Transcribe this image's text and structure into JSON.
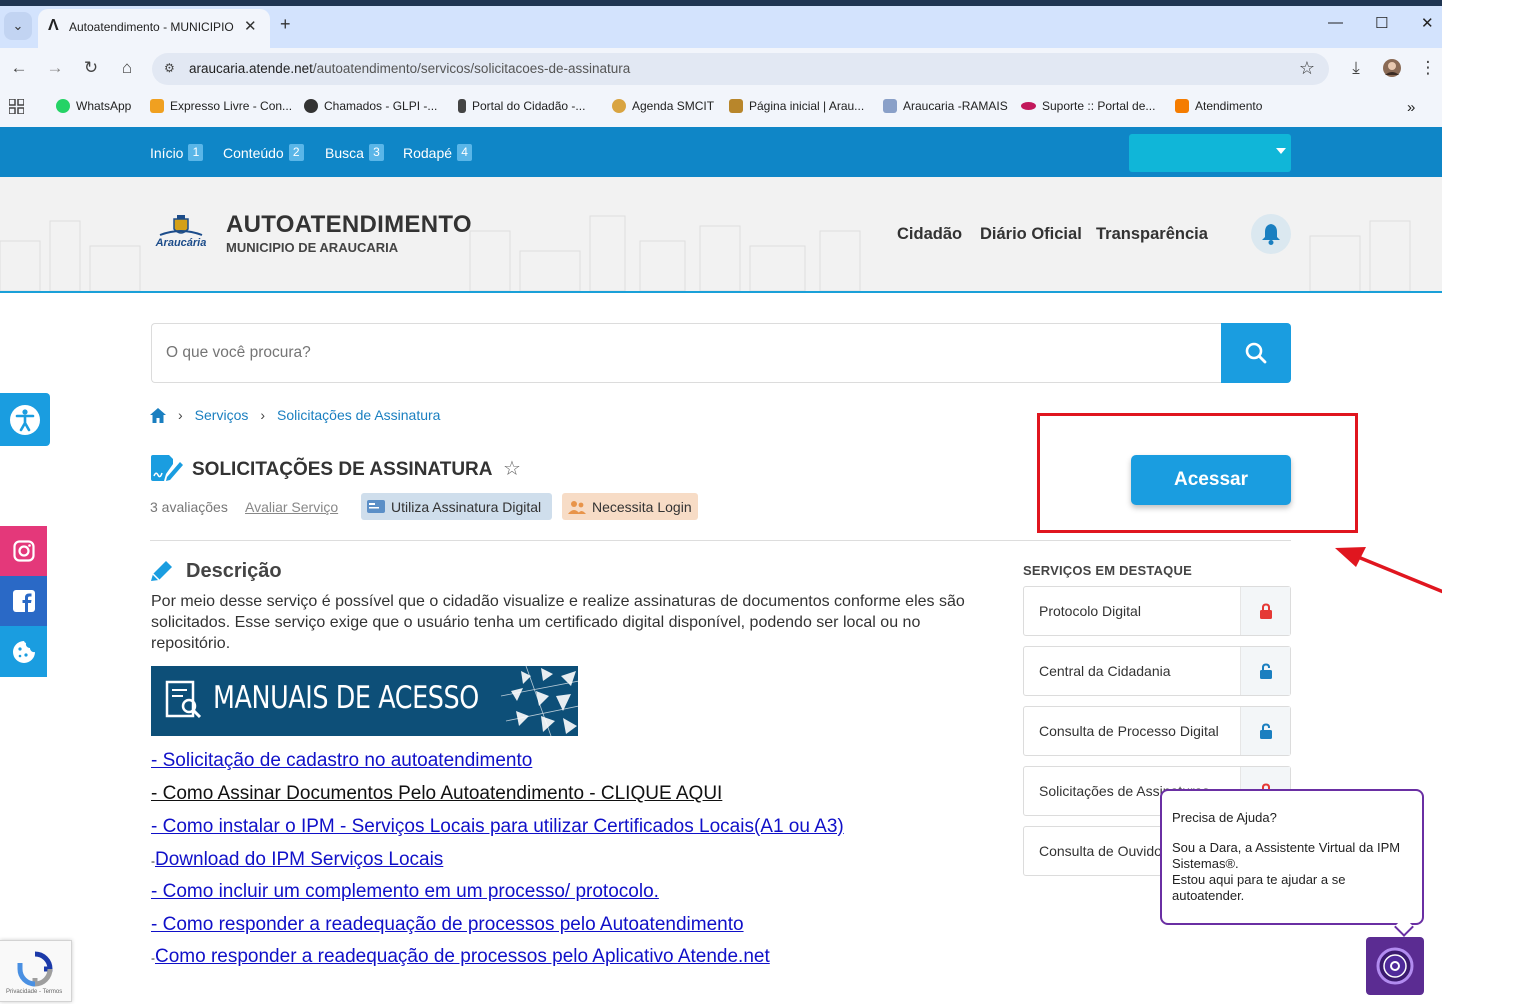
{
  "browser": {
    "tab_title": "Autoatendimento - MUNICIPIO",
    "url_host": "araucaria.atende.net",
    "url_path": "/autoatendimento/servicos/solicitacoes-de-assinatura",
    "bookmarks": [
      {
        "label": "WhatsApp",
        "color": "#25d366"
      },
      {
        "label": "Expresso Livre - Con...",
        "color": "#f0a020"
      },
      {
        "label": "Chamados - GLPI -...",
        "color": "#333333"
      },
      {
        "label": "Portal do Cidadão -...",
        "color": "#444444"
      },
      {
        "label": "Agenda SMCIT",
        "color": "#d9a441"
      },
      {
        "label": "Página inicial | Arau...",
        "color": "#b8862b"
      },
      {
        "label": "Araucaria -RAMAIS",
        "color": "#8aa0c8"
      },
      {
        "label": "Suporte :: Portal de...",
        "color": "#c2185b"
      },
      {
        "label": "Atendimento",
        "color": "#f57c00"
      }
    ]
  },
  "skip_links": [
    {
      "label": "Início",
      "num": "1"
    },
    {
      "label": "Conteúdo",
      "num": "2"
    },
    {
      "label": "Busca",
      "num": "3"
    },
    {
      "label": "Rodapé",
      "num": "4"
    }
  ],
  "header": {
    "logo_text": "Araucária",
    "title": "AUTOATENDIMENTO",
    "subtitle": "MUNICIPIO DE ARAUCARIA",
    "nav": [
      "Cidadão",
      "Diário Oficial",
      "Transparência"
    ]
  },
  "search": {
    "placeholder": "O que você procura?"
  },
  "breadcrumb": {
    "items": [
      "Serviços",
      "Solicitações de Assinatura"
    ]
  },
  "service": {
    "title": "SOLICITAÇÕES DE ASSINATURA",
    "ratings": "3 avaliações",
    "rate_link": "Avaliar Serviço",
    "tags": [
      "Utiliza Assinatura Digital",
      "Necessita Login"
    ],
    "access_button": "Acessar"
  },
  "description": {
    "heading": "Descrição",
    "text": "Por meio desse serviço é possível que o cidadão visualize e realize assinaturas de documentos conforme eles são solicitados. Esse serviço exige que o usuário tenha um certificado digital disponível, podendo ser local ou no repositório.",
    "banner": "MANUAIS DE ACESSO",
    "links": [
      "- Solicitação de cadastro no autoatendimento",
      "- Como Assinar Documentos Pelo Autoatendimento - CLIQUE AQUI",
      "- Como instalar o IPM - Serviços Locais para utilizar Certificados Locais(A1 ou A3)",
      "Download do IPM Serviços Locais",
      "- Como incluir um complemento em um processo/ protocolo.",
      "- Como responder a readequação de processos pelo Autoatendimento",
      "Como responder a readequação de processos pelo Aplicativo Atende.net"
    ],
    "link_lead": "-"
  },
  "sidebar": {
    "heading": "SERVIÇOS EM DESTAQUE",
    "items": [
      {
        "label": "Protocolo Digital",
        "lock": "locked",
        "color": "#e53935"
      },
      {
        "label": "Central da Cidadania",
        "lock": "unlocked",
        "color": "#1a7fc0"
      },
      {
        "label": "Consulta de Processo Digital",
        "lock": "unlocked",
        "color": "#1a7fc0"
      },
      {
        "label": "Solicitações de Assinaturas",
        "lock": "locked",
        "color": "#e53935"
      },
      {
        "label": "Consulta de Ouvidoria",
        "lock": "unlocked",
        "color": "#1a7fc0"
      }
    ]
  },
  "chat": {
    "title": "Precisa de Ajuda?",
    "body_line1": "Sou a Dara, a Assistente Virtual da IPM Sistemas®.",
    "body_line2": "Estou aqui para te ajudar a se autoatender."
  },
  "recaptcha": {
    "terms": "Privacidade - Termos"
  },
  "colors": {
    "brand_blue": "#1a9de0",
    "topbar": "#0f86c7",
    "annotation_red": "#e0161f"
  }
}
